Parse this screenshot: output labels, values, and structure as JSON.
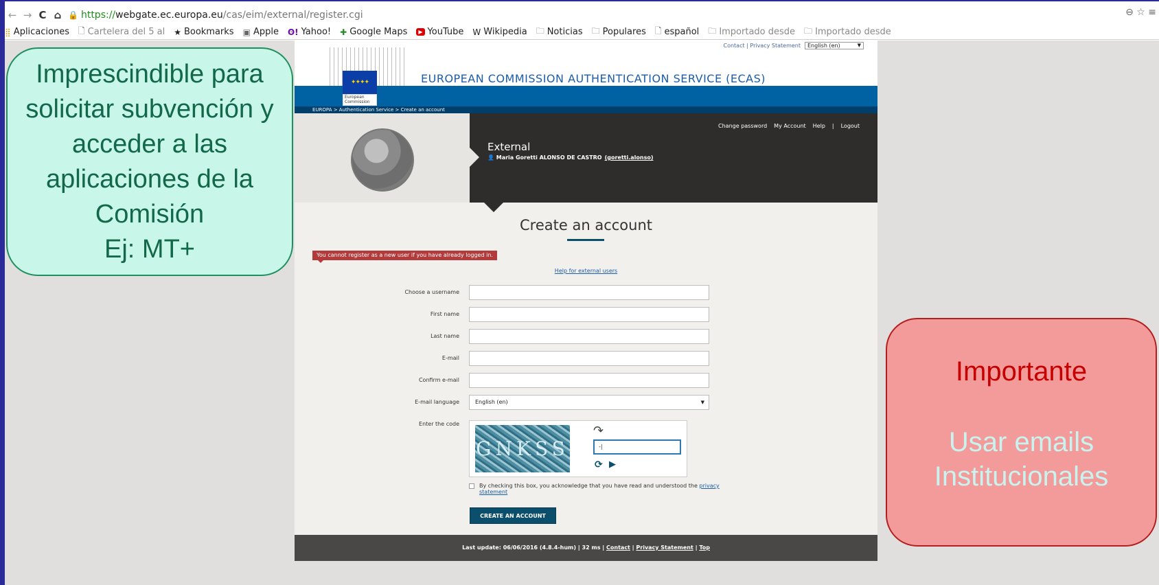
{
  "browser": {
    "url_https": "https://",
    "url_host": "webgate.ec.europa.eu",
    "url_path": "/cas/eim/external/register.cgi",
    "bookmarks": [
      "Aplicaciones",
      "Cartelera del 5 al",
      "Bookmarks",
      "Apple",
      "Yahoo!",
      "Google Maps",
      "YouTube",
      "Wikipedia",
      "Noticias",
      "Populares",
      "español",
      "Importado desde",
      "Importado desde"
    ]
  },
  "ecas": {
    "title": "EUROPEAN COMMISSION AUTHENTICATION SERVICE (ECAS)",
    "logo_text": "European Commission",
    "toplinks": {
      "contact": "Contact",
      "privacy": "Privacy Statement",
      "language": "English (en)"
    },
    "breadcrumb": "EUROPA > Authentication Service > Create an account",
    "user_links": [
      "Change password",
      "My Account",
      "Help",
      "|",
      "Logout"
    ],
    "user_role": "External",
    "user_name": "Maria Goretti ALONSO DE CASTRO",
    "user_login": "(goretti.alonso)",
    "form_title": "Create an account",
    "error": "You cannot register as a new user if you have already logged in.",
    "help_link": "Help for external users",
    "labels": {
      "username": "Choose a username",
      "first_name": "First name",
      "last_name": "Last name",
      "email": "E-mail",
      "confirm_email": "Confirm e-mail",
      "email_language": "E-mail language",
      "enter_code": "Enter the code"
    },
    "email_language_value": "English (en)",
    "captcha_value": "-|",
    "captcha_letters": "GNKSS",
    "privacy_text": "By checking this box, you acknowledge that you have read and understood the",
    "privacy_link": "privacy statement",
    "create_button": "CREATE AN ACCOUNT",
    "footer_update": "Last update: 06/06/2016 (4.8.4-hum) | 32 ms |",
    "footer_contact": "Contact",
    "footer_privacy": "Privacy Statement",
    "footer_top": "Top"
  },
  "callouts": {
    "green_lines": [
      "Imprescindible para",
      "solicitar subvención y",
      "acceder a las",
      "aplicaciones de la",
      "Comisión",
      "Ej: MT+"
    ],
    "red_title": "Importante",
    "red_body_1": "Usar emails",
    "red_body_2": "Institucionales"
  },
  "colors": {
    "accent_blue": "#0062a3",
    "dark_panel": "#2f2d2b",
    "error_red": "#b23a3a",
    "button_teal": "#0b4f6c"
  }
}
